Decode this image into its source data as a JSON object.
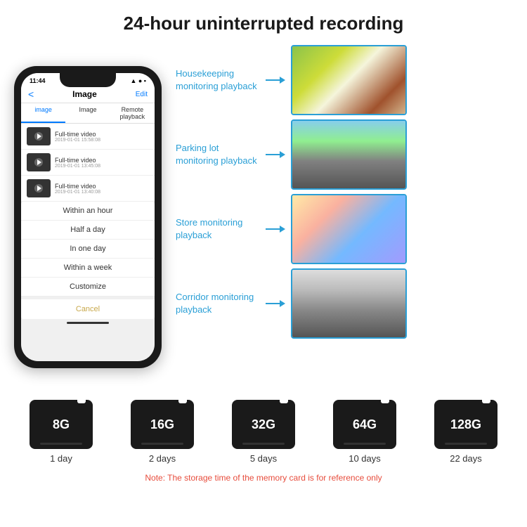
{
  "header": {
    "title": "24-hour uninterrupted recording"
  },
  "phone": {
    "status_time": "11:44",
    "nav_back": "<",
    "nav_title": "Image",
    "nav_edit": "Edit",
    "tabs": [
      "image",
      "Image",
      "Remote playback"
    ],
    "list_items": [
      {
        "title": "Full-time video",
        "date": "2019-01-01 15:58:08"
      },
      {
        "title": "Full-time video",
        "date": "2019-01-01 13:45:08"
      },
      {
        "title": "Full-time video",
        "date": "2019-01-01 13:40:08"
      }
    ],
    "dropdown": {
      "items": [
        "Within an hour",
        "Half a day",
        "In one day",
        "Within a week",
        "Customize"
      ],
      "cancel": "Cancel"
    }
  },
  "monitoring": [
    {
      "label": "Housekeeping\nmonitoring playback",
      "image_type": "housekeeping"
    },
    {
      "label": "Parking lot\nmonitoring playback",
      "image_type": "parking"
    },
    {
      "label": "Store monitoring\nplayback",
      "image_type": "store"
    },
    {
      "label": "Corridor monitoring\nplayback",
      "image_type": "corridor"
    }
  ],
  "sdcards": [
    {
      "size": "8G",
      "days": "1 day"
    },
    {
      "size": "16G",
      "days": "2 days"
    },
    {
      "size": "32G",
      "days": "5 days"
    },
    {
      "size": "64G",
      "days": "10 days"
    },
    {
      "size": "128G",
      "days": "22 days"
    }
  ],
  "note": "Note: The storage time of the memory card is for reference only",
  "colors": {
    "accent_blue": "#2a9fd6",
    "text_dark": "#1a1a1a",
    "note_red": "#e74c3c",
    "phone_bg": "#1a1a1a",
    "sdcard_bg": "#1a1a1a"
  }
}
